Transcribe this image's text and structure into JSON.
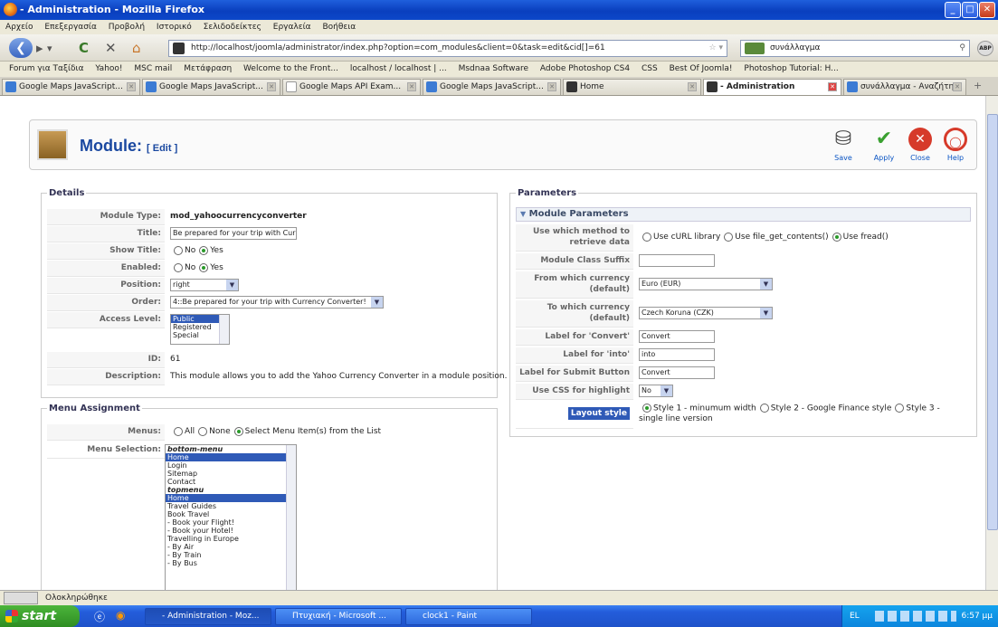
{
  "window": {
    "title": "- Administration - Mozilla Firefox"
  },
  "menubar": [
    "Αρχείο",
    "Επεξεργασία",
    "Προβολή",
    "Ιστορικό",
    "Σελιδοδείκτες",
    "Εργαλεία",
    "Βοήθεια"
  ],
  "nav": {
    "url": "http://localhost/joomla/administrator/index.php?option=com_modules&client=0&task=edit&cid[]=61",
    "search_value": "συνάλλαγμα"
  },
  "bookmarks": [
    "Forum για Ταξίδια",
    "Yahoo!",
    "MSC mail",
    "Μετάφραση",
    "Welcome to the Front...",
    "localhost / localhost | ...",
    "Msdnaa Software",
    "Adobe Photoshop CS4",
    "CSS",
    "Best Of Joomla!",
    "Photoshop Tutorial: H..."
  ],
  "tabs": [
    {
      "label": "Google Maps JavaScript..."
    },
    {
      "label": "Google Maps JavaScript..."
    },
    {
      "label": "Google Maps API Exam..."
    },
    {
      "label": "Google Maps JavaScript..."
    },
    {
      "label": "Home"
    },
    {
      "label": "- Administration"
    },
    {
      "label": "συνάλλαγμα - Αναζήτη..."
    }
  ],
  "page": {
    "title": "Module:",
    "subtitle": "[ Edit ]",
    "toolbar": {
      "save": "Save",
      "apply": "Apply",
      "close": "Close",
      "help": "Help"
    }
  },
  "details": {
    "legend": "Details",
    "module_type_label": "Module Type:",
    "module_type": "mod_yahoocurrencyconverter",
    "title_label": "Title:",
    "title_value": "Be prepared for your trip with Cur",
    "show_title_label": "Show Title:",
    "enabled_label": "Enabled:",
    "no": "No",
    "yes": "Yes",
    "position_label": "Position:",
    "position_value": "right",
    "order_label": "Order:",
    "order_value": "4::Be prepared for your trip with Currency Converter!",
    "access_label": "Access Level:",
    "access_options": [
      "Public",
      "Registered",
      "Special"
    ],
    "id_label": "ID:",
    "id_value": "61",
    "description_label": "Description:",
    "description": "This module allows you to add the Yahoo Currency Converter in a module position."
  },
  "menu_assignment": {
    "legend": "Menu Assignment",
    "menus_label": "Menus:",
    "opt_all": "All",
    "opt_none": "None",
    "opt_select": "Select Menu Item(s) from the List",
    "selection_label": "Menu Selection:",
    "items": [
      {
        "text": "bottom-menu",
        "kind": "grp"
      },
      {
        "text": "Home",
        "kind": "sel"
      },
      {
        "text": "Login",
        "kind": ""
      },
      {
        "text": "Sitemap",
        "kind": ""
      },
      {
        "text": "Contact",
        "kind": ""
      },
      {
        "text": "topmenu",
        "kind": "grp"
      },
      {
        "text": "Home",
        "kind": "sel"
      },
      {
        "text": "Travel Guides",
        "kind": ""
      },
      {
        "text": "Book Travel",
        "kind": ""
      },
      {
        "text": "- Book your Flight!",
        "kind": ""
      },
      {
        "text": "- Book your Hotel!",
        "kind": ""
      },
      {
        "text": "Travelling in Europe",
        "kind": ""
      },
      {
        "text": "- By Air",
        "kind": ""
      },
      {
        "text": "- By Train",
        "kind": ""
      },
      {
        "text": "- By Bus",
        "kind": ""
      }
    ]
  },
  "parameters": {
    "legend": "Parameters",
    "panel_title": "Module Parameters",
    "method_label": "Use which method to retrieve data",
    "method_curl": "Use cURL library",
    "method_fgc": "Use file_get_contents()",
    "method_fread": "Use fread()",
    "class_suffix_label": "Module Class Suffix",
    "class_suffix_value": "",
    "from_label": "From which currency (default)",
    "from_value": "Euro (EUR)",
    "to_label": "To which currency (default)",
    "to_value": "Czech Koruna (CZK)",
    "convert_label": "Label for 'Convert'",
    "convert_value": "Convert",
    "into_label": "Label for 'into'",
    "into_value": "into",
    "submit_label": "Label for Submit Button",
    "submit_value": "Convert",
    "css_label": "Use CSS for highlight",
    "css_value": "No",
    "layout_label": "Layout style",
    "style1": "Style 1 - minumum width",
    "style2": "Style 2 - Google Finance style",
    "style3": "Style 3 - single line version"
  },
  "statusbar": {
    "text": "Ολοκληρώθηκε"
  },
  "taskbar": {
    "start": "start",
    "tasks": [
      "- Administration - Moz...",
      "Πτυχιακή - Microsoft ...",
      "clock1 - Paint"
    ],
    "lang": "EL",
    "time": "6:57 μμ"
  }
}
